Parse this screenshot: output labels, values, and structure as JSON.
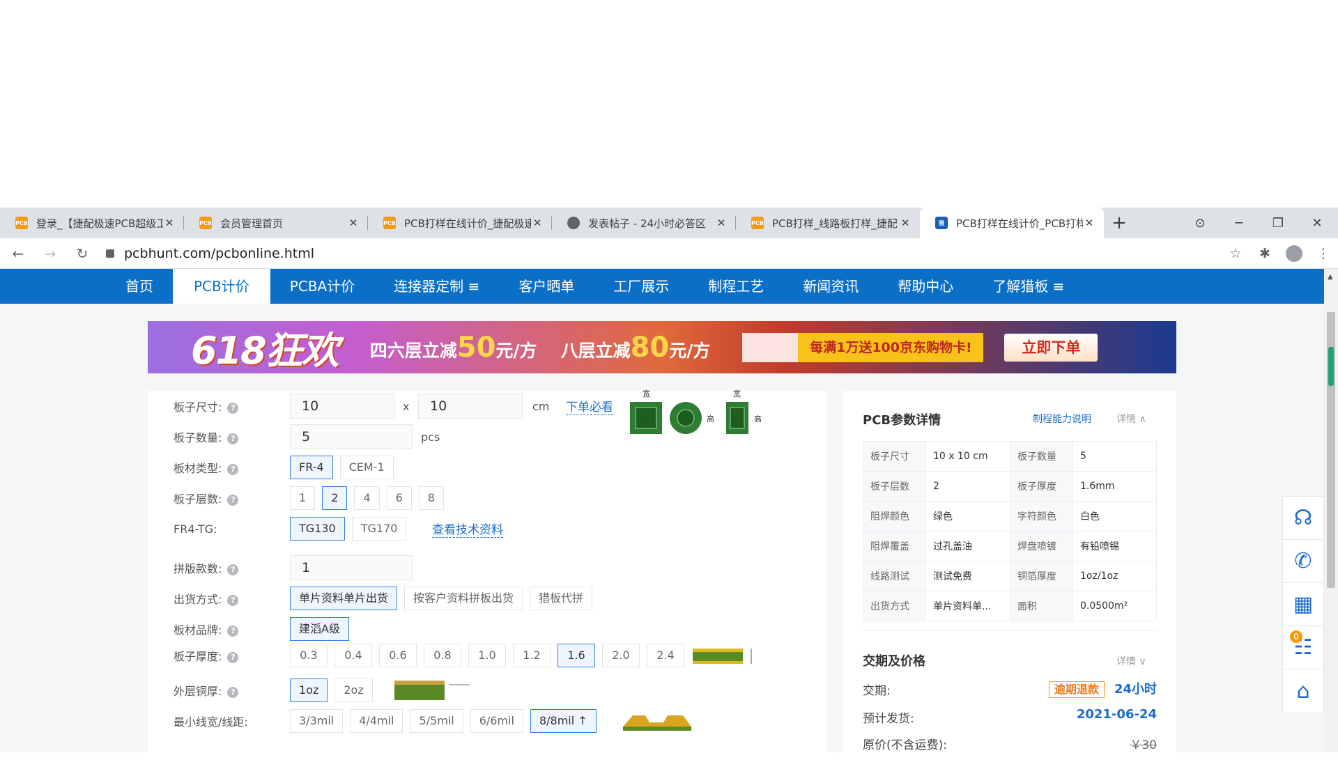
{
  "browser": {
    "tabs": [
      {
        "title": "登录_【捷配极速PCB超级工",
        "fav": "PCB",
        "active": false
      },
      {
        "title": "会员管理首页",
        "fav": "PCB",
        "active": false
      },
      {
        "title": "PCB打样在线计价_捷配极速",
        "fav": "PCB",
        "active": false
      },
      {
        "title": "发表帖子 - 24小时必答区",
        "fav": "",
        "active": false
      },
      {
        "title": "PCB打样_线路板打样_捷配",
        "fav": "PCB",
        "active": false
      },
      {
        "title": "PCB打样在线计价_PCB打样",
        "fav": "猎",
        "active": true
      }
    ],
    "url": "pcbhunt.com/pcbonline.html"
  },
  "nav": {
    "items": [
      "首页",
      "PCB计价",
      "PCBA计价",
      "连接器定制 ≡",
      "客户晒单",
      "工厂展示",
      "制程工艺",
      "新闻资讯",
      "帮助中心",
      "了解猎板 ≡"
    ],
    "active_index": 1
  },
  "banner": {
    "headline": "618狂欢",
    "promo1_prefix": "四六层立减",
    "promo1_value": "50",
    "promo1_suffix": "元/方",
    "promo2_prefix": "八层立减",
    "promo2_value": "80",
    "promo2_suffix": "元/方",
    "card_text": "每满1万送100京东购物卡!",
    "cta": "立即下单"
  },
  "form": {
    "size": {
      "label": "板子尺寸:",
      "width": "10",
      "x": "x",
      "height": "10",
      "unit": "cm",
      "link": "下单必看",
      "img_w": "宽",
      "img_h": "高"
    },
    "quantity": {
      "label": "板子数量:",
      "value": "5",
      "unit": "pcs"
    },
    "material": {
      "label": "板材类型:",
      "options": [
        "FR-4",
        "CEM-1"
      ],
      "selected": 0
    },
    "layers": {
      "label": "板子层数:",
      "options": [
        "1",
        "2",
        "4",
        "6",
        "8"
      ],
      "selected": 1
    },
    "tg": {
      "label": "FR4-TG:",
      "options": [
        "TG130",
        "TG170"
      ],
      "selected": 0,
      "link": "查看技术资料"
    },
    "panel": {
      "label": "拼版款数:",
      "value": "1"
    },
    "shipping": {
      "label": "出货方式:",
      "options": [
        "单片资料单片出货",
        "按客户资料拼板出货",
        "猎板代拼"
      ],
      "selected": 0
    },
    "brand": {
      "label": "板材品牌:",
      "options": [
        "建滔A级"
      ],
      "selected": 0
    },
    "thickness": {
      "label": "板子厚度:",
      "options": [
        "0.3",
        "0.4",
        "0.6",
        "0.8",
        "1.0",
        "1.2",
        "1.6",
        "2.0",
        "2.4"
      ],
      "selected": 6
    },
    "copper": {
      "label": "外层铜厚:",
      "options": [
        "1oz",
        "2oz"
      ],
      "selected": 0
    },
    "trace": {
      "label": "最小线宽/线距:",
      "options": [
        "3/3mil",
        "4/4mil",
        "5/5mil",
        "6/6mil",
        "8/8mil ↑"
      ],
      "selected": 4
    }
  },
  "params": {
    "title": "PCB参数详情",
    "link": "制程能力说明",
    "detail": "详情 ∧",
    "rows": [
      [
        "板子尺寸",
        "10 x 10 cm",
        "板子数量",
        "5"
      ],
      [
        "板子层数",
        "2",
        "板子厚度",
        "1.6mm"
      ],
      [
        "阻焊颜色",
        "绿色",
        "字符颜色",
        "白色"
      ],
      [
        "阻焊覆盖",
        "过孔盖油",
        "焊盘喷镀",
        "有铅喷锡"
      ],
      [
        "线路测试",
        "测试免费",
        "铜箔厚度",
        "1oz/1oz"
      ],
      [
        "出货方式",
        "单片资料单...",
        "面积",
        "0.0500m²"
      ]
    ]
  },
  "delivery": {
    "title": "交期及价格",
    "detail": "详情 ∨",
    "lead_label": "交期:",
    "lead_tag": "逾期退款",
    "lead_value": "24小时",
    "ship_label": "预计发货:",
    "ship_value": "2021-06-24",
    "price_label": "原价(不含运费):",
    "price_value": "￥30"
  },
  "floatbar": {
    "cart_count": "0"
  }
}
